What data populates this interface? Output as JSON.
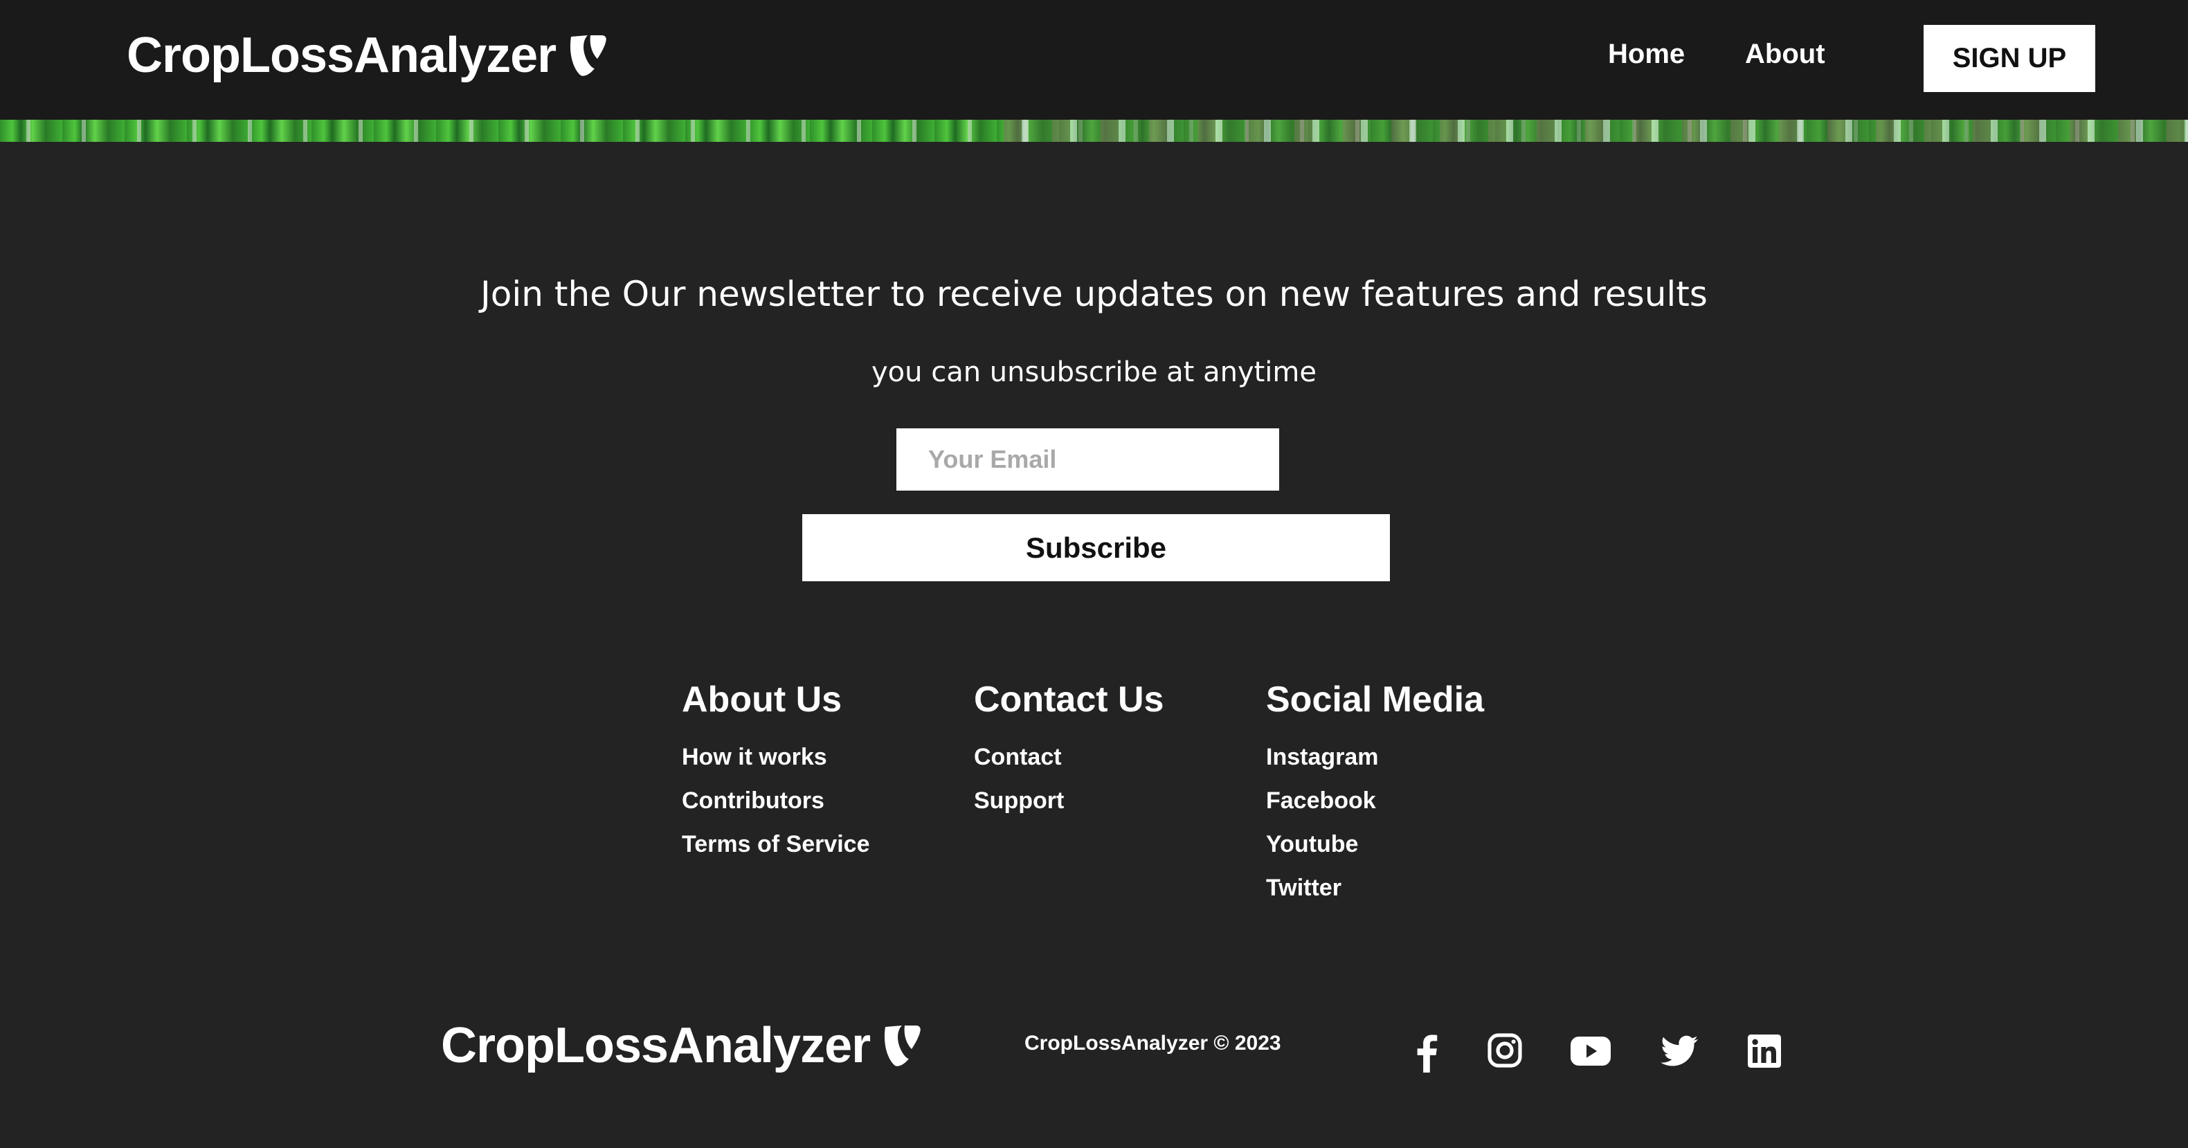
{
  "navbar": {
    "brand": "CropLossAnalyzer",
    "logo_icon": "typo3-logo-icon",
    "links": [
      {
        "label": "Home"
      },
      {
        "label": "About"
      }
    ],
    "signup_label": "SIGN UP"
  },
  "newsletter": {
    "heading": "Join the Our newsletter to receive updates on new features and results",
    "subheading": "you can unsubscribe at anytime",
    "email_placeholder": "Your Email",
    "email_value": "",
    "subscribe_label": "Subscribe"
  },
  "footer": {
    "columns": [
      {
        "heading": "About Us",
        "links": [
          "How it works",
          "Contributors",
          "Terms of Service"
        ]
      },
      {
        "heading": "Contact Us",
        "links": [
          "Contact",
          "Support"
        ]
      },
      {
        "heading": "Social Media",
        "links": [
          "Instagram",
          "Facebook",
          "Youtube",
          "Twitter"
        ]
      }
    ],
    "brand": "CropLossAnalyzer",
    "copyright": "CropLossAnalyzer © 2023",
    "social_icons": [
      "facebook-icon",
      "instagram-icon",
      "youtube-icon",
      "twitter-icon",
      "linkedin-icon"
    ]
  },
  "colors": {
    "page_background": "#232323",
    "navbar_background": "#1b1a1a",
    "text": "#ffffff",
    "button_background": "#ffffff",
    "button_text": "#111111",
    "placeholder_text": "#a9a9a9"
  }
}
